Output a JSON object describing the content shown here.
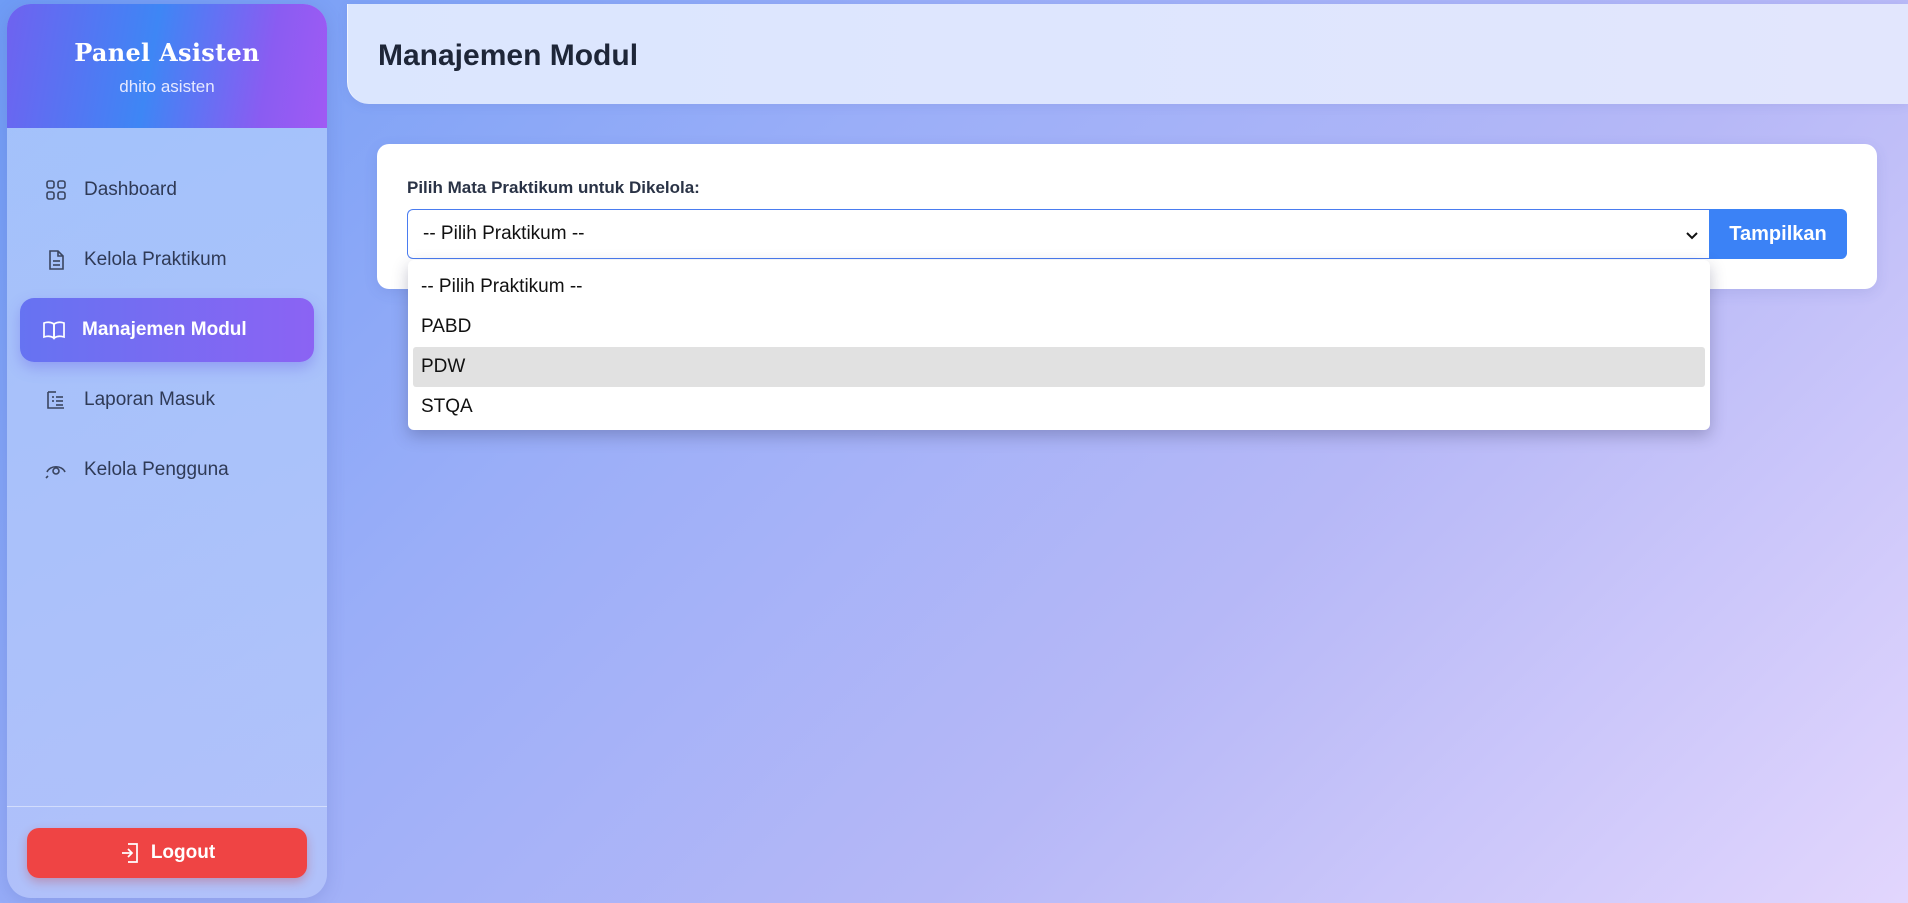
{
  "sidebar": {
    "title": "Panel Asisten",
    "user": "dhito asisten",
    "items": [
      {
        "label": "Dashboard",
        "icon": "grid-icon"
      },
      {
        "label": "Kelola Praktikum",
        "icon": "document-icon"
      },
      {
        "label": "Manajemen Modul",
        "icon": "book-icon",
        "active": true
      },
      {
        "label": "Laporan Masuk",
        "icon": "list-icon"
      },
      {
        "label": "Kelola Pengguna",
        "icon": "user-eye-icon"
      }
    ],
    "logout_label": "Logout"
  },
  "header": {
    "title": "Manajemen Modul"
  },
  "card": {
    "label": "Pilih Mata Praktikum untuk Dikelola:",
    "select_value": "-- Pilih Praktikum --",
    "button_label": "Tampilkan"
  },
  "dropdown": {
    "options": [
      "-- Pilih Praktikum --",
      "PABD",
      "PDW",
      "STQA"
    ],
    "highlighted": "PDW"
  },
  "colors": {
    "accent": "#3b82f6",
    "active_nav": "#7a6bf3",
    "logout": "#ef4444"
  }
}
